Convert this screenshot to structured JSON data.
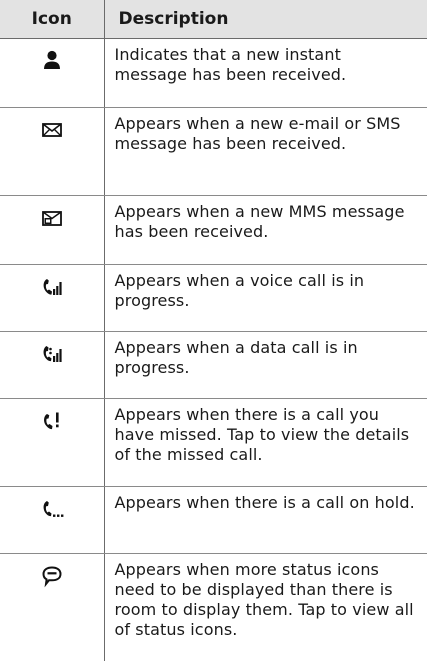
{
  "table": {
    "headers": {
      "icon": "Icon",
      "description": "Description"
    },
    "rows": [
      {
        "icon": "person-icon",
        "description": "Indicates that a new instant message has been received."
      },
      {
        "icon": "envelope-icon",
        "description": "Appears when a new e-mail or SMS message has been received."
      },
      {
        "icon": "mms-envelope-icon",
        "description": "Appears when a new MMS message has been received."
      },
      {
        "icon": "voice-call-icon",
        "description": "Appears when a voice call is in progress."
      },
      {
        "icon": "data-call-icon",
        "description": "Appears when a data call is in progress."
      },
      {
        "icon": "missed-call-icon",
        "description": "Appears when there is a call you have missed. Tap to view the details of the missed call."
      },
      {
        "icon": "call-on-hold-icon",
        "description": "Appears when there is a call on hold."
      },
      {
        "icon": "more-status-icons-icon",
        "description": "Appears when more status icons need to be displayed than there is room to display them. Tap to view all of status icons."
      }
    ]
  }
}
